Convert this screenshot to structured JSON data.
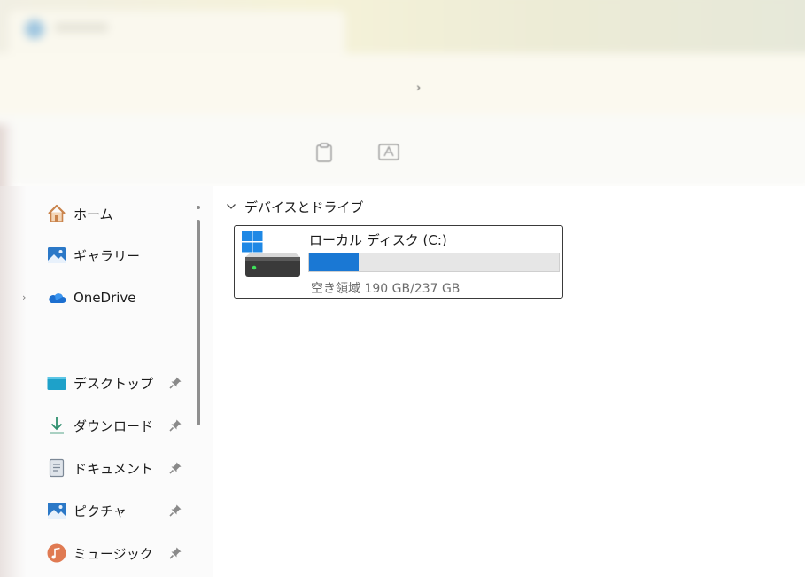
{
  "sidebar": {
    "items": [
      {
        "label": "ホーム",
        "icon": "home-icon"
      },
      {
        "label": "ギャラリー",
        "icon": "gallery-icon"
      },
      {
        "label": "OneDrive",
        "icon": "onedrive-cloud-icon"
      },
      {
        "label": "デスクトップ",
        "icon": "desktop-folder-icon",
        "pinned": true
      },
      {
        "label": "ダウンロード",
        "icon": "download-arrow-icon",
        "pinned": true
      },
      {
        "label": "ドキュメント",
        "icon": "document-icon",
        "pinned": true
      },
      {
        "label": "ピクチャ",
        "icon": "pictures-icon",
        "pinned": true
      },
      {
        "label": "ミュージック",
        "icon": "music-icon",
        "pinned": true
      }
    ]
  },
  "content": {
    "section_title": "デバイスとドライブ",
    "drives": [
      {
        "name": "ローカル ディスク (C:)",
        "free_space_text": "空き領域 190 GB/237 GB",
        "used_fraction": 0.198,
        "icon": "windows-drive-icon"
      }
    ]
  },
  "colors": {
    "accent": "#1a78d4",
    "bar_track": "#e6e6e6",
    "secondary_text": "#6d6d6d"
  }
}
